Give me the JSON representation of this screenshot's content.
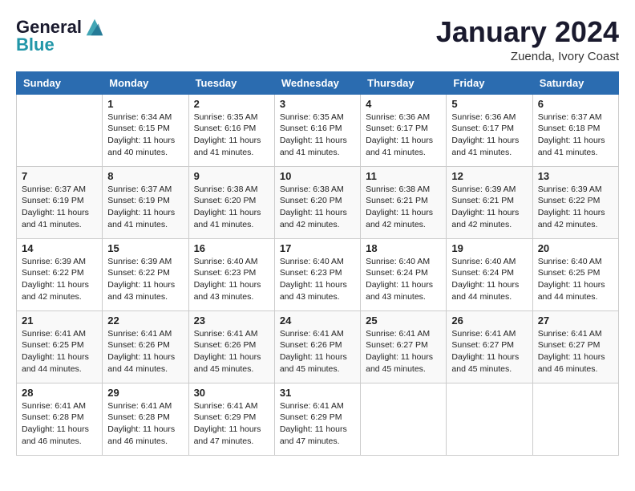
{
  "header": {
    "logo_line1": "General",
    "logo_line2": "Blue",
    "month_title": "January 2024",
    "location": "Zuenda, Ivory Coast"
  },
  "days_of_week": [
    "Sunday",
    "Monday",
    "Tuesday",
    "Wednesday",
    "Thursday",
    "Friday",
    "Saturday"
  ],
  "weeks": [
    [
      {
        "day": "",
        "info": ""
      },
      {
        "day": "1",
        "info": "Sunrise: 6:34 AM\nSunset: 6:15 PM\nDaylight: 11 hours\nand 40 minutes."
      },
      {
        "day": "2",
        "info": "Sunrise: 6:35 AM\nSunset: 6:16 PM\nDaylight: 11 hours\nand 41 minutes."
      },
      {
        "day": "3",
        "info": "Sunrise: 6:35 AM\nSunset: 6:16 PM\nDaylight: 11 hours\nand 41 minutes."
      },
      {
        "day": "4",
        "info": "Sunrise: 6:36 AM\nSunset: 6:17 PM\nDaylight: 11 hours\nand 41 minutes."
      },
      {
        "day": "5",
        "info": "Sunrise: 6:36 AM\nSunset: 6:17 PM\nDaylight: 11 hours\nand 41 minutes."
      },
      {
        "day": "6",
        "info": "Sunrise: 6:37 AM\nSunset: 6:18 PM\nDaylight: 11 hours\nand 41 minutes."
      }
    ],
    [
      {
        "day": "7",
        "info": "Sunrise: 6:37 AM\nSunset: 6:19 PM\nDaylight: 11 hours\nand 41 minutes."
      },
      {
        "day": "8",
        "info": "Sunrise: 6:37 AM\nSunset: 6:19 PM\nDaylight: 11 hours\nand 41 minutes."
      },
      {
        "day": "9",
        "info": "Sunrise: 6:38 AM\nSunset: 6:20 PM\nDaylight: 11 hours\nand 41 minutes."
      },
      {
        "day": "10",
        "info": "Sunrise: 6:38 AM\nSunset: 6:20 PM\nDaylight: 11 hours\nand 42 minutes."
      },
      {
        "day": "11",
        "info": "Sunrise: 6:38 AM\nSunset: 6:21 PM\nDaylight: 11 hours\nand 42 minutes."
      },
      {
        "day": "12",
        "info": "Sunrise: 6:39 AM\nSunset: 6:21 PM\nDaylight: 11 hours\nand 42 minutes."
      },
      {
        "day": "13",
        "info": "Sunrise: 6:39 AM\nSunset: 6:22 PM\nDaylight: 11 hours\nand 42 minutes."
      }
    ],
    [
      {
        "day": "14",
        "info": "Sunrise: 6:39 AM\nSunset: 6:22 PM\nDaylight: 11 hours\nand 42 minutes."
      },
      {
        "day": "15",
        "info": "Sunrise: 6:39 AM\nSunset: 6:22 PM\nDaylight: 11 hours\nand 43 minutes."
      },
      {
        "day": "16",
        "info": "Sunrise: 6:40 AM\nSunset: 6:23 PM\nDaylight: 11 hours\nand 43 minutes."
      },
      {
        "day": "17",
        "info": "Sunrise: 6:40 AM\nSunset: 6:23 PM\nDaylight: 11 hours\nand 43 minutes."
      },
      {
        "day": "18",
        "info": "Sunrise: 6:40 AM\nSunset: 6:24 PM\nDaylight: 11 hours\nand 43 minutes."
      },
      {
        "day": "19",
        "info": "Sunrise: 6:40 AM\nSunset: 6:24 PM\nDaylight: 11 hours\nand 44 minutes."
      },
      {
        "day": "20",
        "info": "Sunrise: 6:40 AM\nSunset: 6:25 PM\nDaylight: 11 hours\nand 44 minutes."
      }
    ],
    [
      {
        "day": "21",
        "info": "Sunrise: 6:41 AM\nSunset: 6:25 PM\nDaylight: 11 hours\nand 44 minutes."
      },
      {
        "day": "22",
        "info": "Sunrise: 6:41 AM\nSunset: 6:26 PM\nDaylight: 11 hours\nand 44 minutes."
      },
      {
        "day": "23",
        "info": "Sunrise: 6:41 AM\nSunset: 6:26 PM\nDaylight: 11 hours\nand 45 minutes."
      },
      {
        "day": "24",
        "info": "Sunrise: 6:41 AM\nSunset: 6:26 PM\nDaylight: 11 hours\nand 45 minutes."
      },
      {
        "day": "25",
        "info": "Sunrise: 6:41 AM\nSunset: 6:27 PM\nDaylight: 11 hours\nand 45 minutes."
      },
      {
        "day": "26",
        "info": "Sunrise: 6:41 AM\nSunset: 6:27 PM\nDaylight: 11 hours\nand 45 minutes."
      },
      {
        "day": "27",
        "info": "Sunrise: 6:41 AM\nSunset: 6:27 PM\nDaylight: 11 hours\nand 46 minutes."
      }
    ],
    [
      {
        "day": "28",
        "info": "Sunrise: 6:41 AM\nSunset: 6:28 PM\nDaylight: 11 hours\nand 46 minutes."
      },
      {
        "day": "29",
        "info": "Sunrise: 6:41 AM\nSunset: 6:28 PM\nDaylight: 11 hours\nand 46 minutes."
      },
      {
        "day": "30",
        "info": "Sunrise: 6:41 AM\nSunset: 6:29 PM\nDaylight: 11 hours\nand 47 minutes."
      },
      {
        "day": "31",
        "info": "Sunrise: 6:41 AM\nSunset: 6:29 PM\nDaylight: 11 hours\nand 47 minutes."
      },
      {
        "day": "",
        "info": ""
      },
      {
        "day": "",
        "info": ""
      },
      {
        "day": "",
        "info": ""
      }
    ]
  ]
}
